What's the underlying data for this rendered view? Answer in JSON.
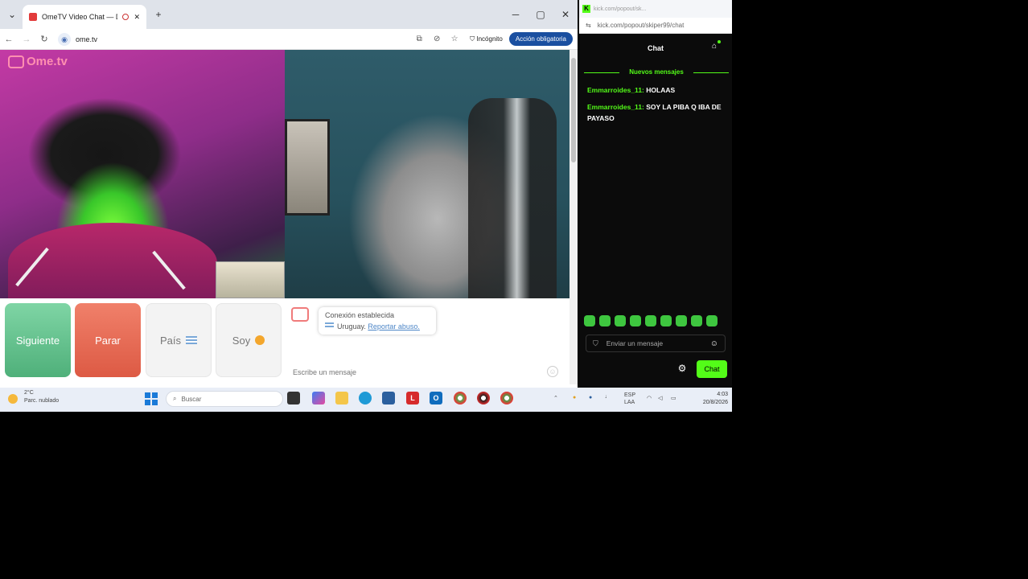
{
  "chrome": {
    "tab_title": "OmeTV Video Chat — Dev",
    "new_tab": "+",
    "minimize": "─",
    "maximize": "▢",
    "close": "✕",
    "url": "ome.tv",
    "incognito": "Incógnito",
    "action_required": "Acción obligatoria"
  },
  "ometv": {
    "logo": "Ome.tv",
    "buttons": {
      "next": "Siguiente",
      "stop": "Parar",
      "country": "País",
      "gender": "Soy"
    },
    "status": {
      "connected": "Conexión establecida",
      "country": "Uruguay.",
      "report": "Reportar abuso."
    },
    "message_placeholder": "Escribe un mensaje"
  },
  "kick": {
    "window_title": "kick.com/popout/sk...",
    "url": "kick.com/popout/skiper99/chat",
    "header": "Chat",
    "new_messages": "Nuevos mensajes",
    "messages": [
      {
        "user": "Emmarroides_11:",
        "text": "HOLAAS"
      },
      {
        "user": "Emmarroides_11:",
        "text": "SOY LA PIBA Q IBA DE PAYASO"
      }
    ],
    "input_placeholder": "Enviar un mensaje",
    "send": "Chat",
    "accent": "#53fc18"
  },
  "taskbar": {
    "weather_temp": "2°C",
    "weather_desc": "Parc. nublado",
    "search": "Buscar",
    "lang_top": "ESP",
    "lang_bottom": "LAA",
    "time": "4:03",
    "date": "20/8/2026"
  }
}
